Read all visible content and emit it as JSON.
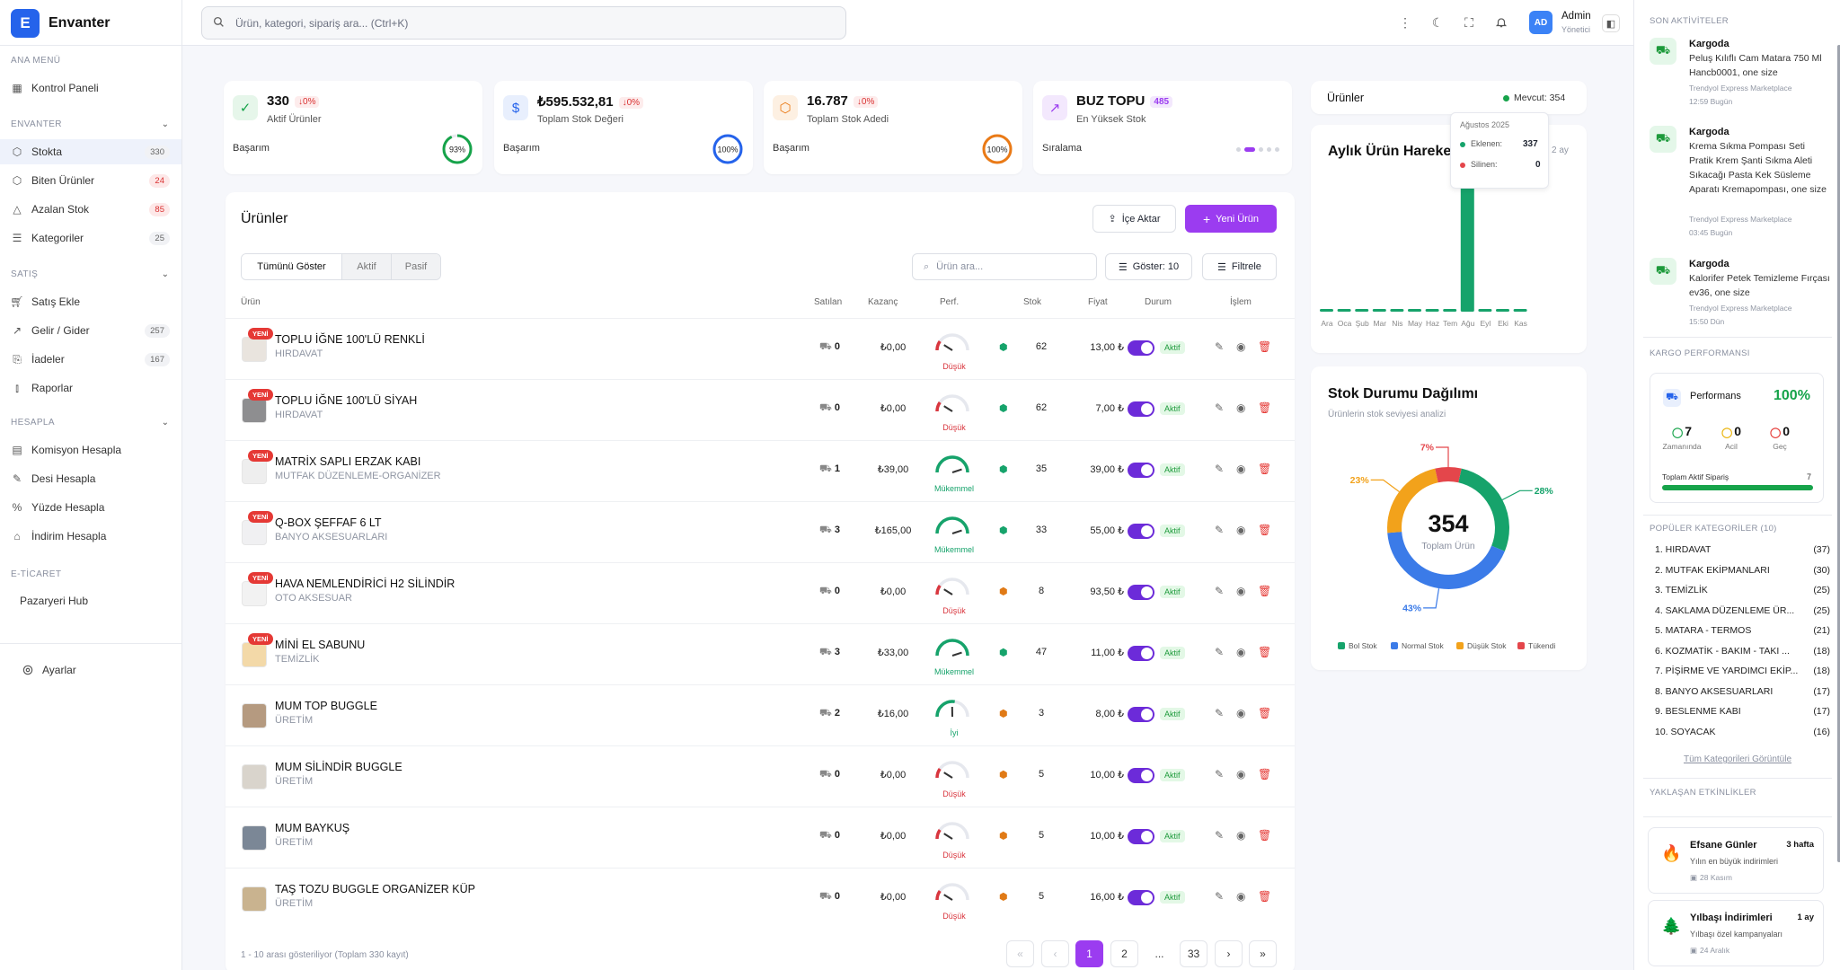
{
  "app": {
    "logo_letter": "E",
    "name": "Envanter"
  },
  "search": {
    "placeholder": "Ürün, kategori, sipariş ara... (Ctrl+K)"
  },
  "user": {
    "initials": "AD",
    "name": "Admin",
    "role": "Yönetici"
  },
  "sidebar": {
    "sections": [
      {
        "title": "ANA MENÜ",
        "items": [
          {
            "label": "Kontrol Paneli",
            "icon": "grid-icon"
          }
        ]
      },
      {
        "title": "ENVANTER",
        "items": [
          {
            "label": "Stokta",
            "count": "330",
            "icon": "box-icon",
            "active": true
          },
          {
            "label": "Biten Ürünler",
            "count": "24",
            "icon": "box-icon",
            "red": true
          },
          {
            "label": "Azalan Stok",
            "count": "85",
            "icon": "warning-icon",
            "red": true
          },
          {
            "label": "Kategoriler",
            "count": "25",
            "icon": "list-icon"
          }
        ]
      },
      {
        "title": "SATIŞ",
        "items": [
          {
            "label": "Satış Ekle",
            "icon": "cart-icon"
          },
          {
            "label": "Gelir / Gider",
            "count": "257",
            "icon": "trend-icon"
          },
          {
            "label": "İadeler",
            "count": "167",
            "icon": "return-icon"
          },
          {
            "label": "Raporlar",
            "icon": "bar-chart-icon"
          }
        ]
      },
      {
        "title": "HESAPLA",
        "items": [
          {
            "label": "Komisyon Hesapla",
            "icon": "calculator-icon"
          },
          {
            "label": "Desi Hesapla",
            "icon": "pen-icon"
          },
          {
            "label": "Yüzde Hesapla",
            "icon": "percent-icon"
          },
          {
            "label": "İndirim Hesapla",
            "icon": "tag-icon"
          }
        ]
      },
      {
        "title": "E-TİCARET",
        "items": [
          {
            "label": "Pazaryeri Hub",
            "icon": ""
          }
        ]
      }
    ],
    "settings": "Ayarlar"
  },
  "kpis": [
    {
      "value": "330",
      "delta": "↓0%",
      "label": "Aktif Ürünler",
      "foot": "Başarım",
      "pct": "93%",
      "ratio": 0.93,
      "color": "#16a34a",
      "icon_bg": "#e6f6ea",
      "icon": "✓",
      "icon_name": "check-icon"
    },
    {
      "value": "₺595.532,81",
      "delta": "↓0%",
      "label": "Toplam Stok Değeri",
      "foot": "Başarım",
      "pct": "100%",
      "ratio": 1,
      "color": "#2563eb",
      "icon_bg": "#e8effd",
      "icon": "$",
      "icon_name": "dollar-icon"
    },
    {
      "value": "16.787",
      "delta": "↓0%",
      "label": "Toplam Stok Adedi",
      "foot": "Başarım",
      "pct": "100%",
      "ratio": 1,
      "color": "#ea7a16",
      "icon_bg": "#fdf0e2",
      "icon": "⬡",
      "icon_name": "box-icon"
    },
    {
      "value": "BUZ TOPU",
      "delta": "485",
      "label": "En Yüksek Stok",
      "foot": "Sıralama",
      "icon_bg": "#f3e8fd",
      "icon": "↗",
      "icon_name": "trend-up-icon"
    }
  ],
  "products_panel": {
    "title": "Ürünler",
    "import_btn": "İçe Aktar",
    "new_btn": "Yeni Ürün",
    "tabs": [
      "Tümünü Göster",
      "Aktif",
      "Pasif"
    ],
    "search_placeholder": "Ürün ara...",
    "show_btn": "Göster: 10",
    "filter_btn": "Filtrele",
    "columns": [
      "Ürün",
      "Satılan",
      "Kazanç",
      "Perf.",
      "Stok",
      "Fiyat",
      "Durum",
      "İşlem"
    ],
    "rows": [
      {
        "name": "TOPLU İĞNE 100'LÜ RENKLİ",
        "cat": "HIRDAVAT",
        "new": "YENİ",
        "sold": "0",
        "earn": "₺0,00",
        "perf": "Düşük",
        "stock": "62",
        "price": "13,00 ₺",
        "status": "Aktif",
        "thumb": "#e9e4de"
      },
      {
        "name": "TOPLU İĞNE 100'LÜ SİYAH",
        "cat": "HIRDAVAT",
        "new": "YENİ",
        "sold": "0",
        "earn": "₺0,00",
        "perf": "Düşük",
        "stock": "62",
        "price": "7,00 ₺",
        "status": "Aktif",
        "thumb": "#8e8e90"
      },
      {
        "name": "MATRİX SAPLI ERZAK KABI",
        "cat": "MUTFAK DÜZENLEME-ORGANİZER",
        "new": "YENİ",
        "sold": "1",
        "earn": "₺39,00",
        "perf": "Mükemmel",
        "stock": "35",
        "price": "39,00 ₺",
        "status": "Aktif",
        "thumb": "#eeeeee"
      },
      {
        "name": "Q-BOX ŞEFFAF 6 LT",
        "cat": "BANYO AKSESUARLARI",
        "new": "YENİ",
        "sold": "3",
        "earn": "₺165,00",
        "perf": "Mükemmel",
        "stock": "33",
        "price": "55,00 ₺",
        "status": "Aktif",
        "thumb": "#f0f0f2"
      },
      {
        "name": "HAVA NEMLENDİRİCİ H2 SİLİNDİR",
        "cat": "OTO AKSESUAR",
        "new": "YENİ",
        "sold": "0",
        "earn": "₺0,00",
        "perf": "Düşük",
        "stock": "8",
        "price": "93,50 ₺",
        "status": "Aktif",
        "thumb": "#f2f2f2"
      },
      {
        "name": "MİNİ EL SABUNU",
        "cat": "TEMİZLİK",
        "new": "YENİ",
        "sold": "3",
        "earn": "₺33,00",
        "perf": "Mükemmel",
        "stock": "47",
        "price": "11,00 ₺",
        "status": "Aktif",
        "thumb": "#f3d9a8"
      },
      {
        "name": "MUM TOP BUGGLE",
        "cat": "ÜRETİM",
        "new": "",
        "sold": "2",
        "earn": "₺16,00",
        "perf": "İyi",
        "stock": "3",
        "price": "8,00 ₺",
        "status": "Aktif",
        "thumb": "#b59a80"
      },
      {
        "name": "MUM SİLİNDİR BUGGLE",
        "cat": "ÜRETİM",
        "new": "",
        "sold": "0",
        "earn": "₺0,00",
        "perf": "Düşük",
        "stock": "5",
        "price": "10,00 ₺",
        "status": "Aktif",
        "thumb": "#d9d4cc"
      },
      {
        "name": "MUM BAYKUŞ",
        "cat": "ÜRETİM",
        "new": "",
        "sold": "0",
        "earn": "₺0,00",
        "perf": "Düşük",
        "stock": "5",
        "price": "10,00 ₺",
        "status": "Aktif",
        "thumb": "#7b8796"
      },
      {
        "name": "TAŞ TOZU BUGGLE ORGANİZER KÜP",
        "cat": "ÜRETİM",
        "new": "",
        "sold": "0",
        "earn": "₺0,00",
        "perf": "Düşük",
        "stock": "5",
        "price": "16,00 ₺",
        "status": "Aktif",
        "thumb": "#c9b38f"
      }
    ],
    "footer": "1 - 10 arası gösteriliyor (Toplam 330 kayıt)",
    "pagination": [
      "«",
      "‹",
      "1",
      "2",
      "...",
      "33",
      "›",
      "»"
    ]
  },
  "products_summary": {
    "title": "Ürünler",
    "status": "Mevcut: 354"
  },
  "chart_data": [
    {
      "type": "bar",
      "title": "Aylık Ürün Hareke",
      "subtitle": "2 ay",
      "categories": [
        "Ara",
        "Oca",
        "Şub",
        "Mar",
        "Nis",
        "May",
        "Haz",
        "Tem",
        "Ağu",
        "Eyl",
        "Eki",
        "Kas"
      ],
      "series": [
        {
          "name": "Eklenen",
          "values": [
            2,
            2,
            2,
            2,
            2,
            2,
            2,
            2,
            337,
            2,
            6,
            2
          ]
        },
        {
          "name": "Silinen",
          "values": [
            0,
            0,
            0,
            0,
            0,
            0,
            0,
            0,
            0,
            0,
            0,
            0
          ]
        }
      ],
      "tooltip": {
        "title": "Ağustos 2025",
        "rows": [
          {
            "label": "Eklenen:",
            "value": "337"
          },
          {
            "label": "Silinen:",
            "value": "0"
          }
        ]
      }
    },
    {
      "type": "pie",
      "title": "Stok Durumu Dağılımı",
      "subtitle": "Ürünlerin stok seviyesi analizi",
      "center_value": "354",
      "center_label": "Toplam Ürün",
      "slices": [
        {
          "name": "Bol Stok",
          "value": 28,
          "label": "28%",
          "color": "#16a36b"
        },
        {
          "name": "Normal Stok",
          "value": 43,
          "label": "43%",
          "color": "#3b7be8"
        },
        {
          "name": "Düşük Stok",
          "value": 23,
          "label": "23%",
          "color": "#f2a21b"
        },
        {
          "name": "Tükendi",
          "value": 7,
          "label": "7%",
          "color": "#e4464b"
        }
      ]
    }
  ],
  "right_panel": {
    "activity_title": "SON AKTİVİTELER",
    "activities": [
      {
        "title": "Kargoda",
        "desc": "Peluş Kılıflı Cam Matara 750 Ml Hancb0001, one size",
        "source": "Trendyol Express Marketplace",
        "time": "12:59 Bugün"
      },
      {
        "title": "Kargoda",
        "desc": "Krema Sıkma Pompası Seti Pratik Krem Şanti Sıkma Aleti Sıkacağı Pasta Kek Süsleme Aparatı Kremapompası, one size",
        "source": "Trendyol Express Marketplace",
        "time": "03:45 Bugün"
      },
      {
        "title": "Kargoda",
        "desc": "Kalorifer Petek Temizleme Fırçası ev36, one size",
        "source": "Trendyol Express Marketplace",
        "time": "15:50 Dün"
      }
    ],
    "cargo_title": "KARGO PERFORMANSI",
    "cargo": {
      "label": "Performans",
      "value": "100%",
      "stats": [
        {
          "v": "7",
          "l": "Zamanında",
          "c": "#16a34a"
        },
        {
          "v": "0",
          "l": "Acil",
          "c": "#eab308"
        },
        {
          "v": "0",
          "l": "Geç",
          "c": "#e53935"
        }
      ],
      "orders_label": "Toplam Aktif Sipariş",
      "orders": "7",
      "ratio": 1
    },
    "cats_title": "POPÜLER KATEGORİLER (10)",
    "categories": [
      {
        "name": "1. HIRDAVAT",
        "n": "(37)"
      },
      {
        "name": "2. MUTFAK EKİPMANLARI",
        "n": "(30)"
      },
      {
        "name": "3. TEMİZLİK",
        "n": "(25)"
      },
      {
        "name": "4. SAKLAMA DÜZENLEME ÜR...",
        "n": "(25)"
      },
      {
        "name": "5. MATARA - TERMOS",
        "n": "(21)"
      },
      {
        "name": "6. KOZMATİK - BAKIM - TAKI ...",
        "n": "(18)"
      },
      {
        "name": "7. PİŞİRME VE YARDIMCI EKİP...",
        "n": "(18)"
      },
      {
        "name": "8. BANYO AKSESUARLARI",
        "n": "(17)"
      },
      {
        "name": "9. BESLENME KABI",
        "n": "(17)"
      },
      {
        "name": "10. SOYACAK",
        "n": "(16)"
      }
    ],
    "cats_link": "Tüm Kategorileri Görüntüle",
    "events_title": "YAKLAŞAN ETKİNLİKLER",
    "events": [
      {
        "title": "Efsane Günler",
        "when": "3 hafta",
        "desc": "Yılın en büyük indirimleri",
        "date": "28 Kasım",
        "icon": "🔥"
      },
      {
        "title": "Yılbaşı İndirimleri",
        "when": "1 ay",
        "desc": "Yılbaşı özel kampanyaları",
        "date": "24 Aralık",
        "icon": "🌲"
      }
    ]
  }
}
